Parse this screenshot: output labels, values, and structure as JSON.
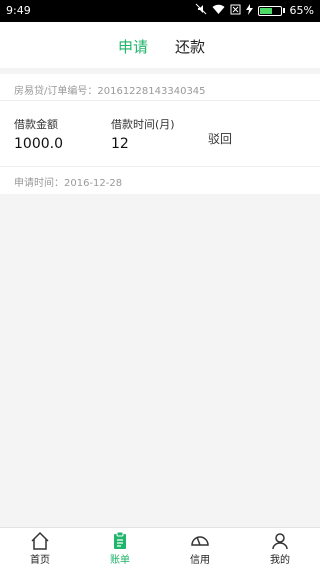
{
  "statusbar": {
    "time": "9:49",
    "battery_pct": "65%",
    "battery_level": 0.65
  },
  "tabs": [
    {
      "label": "申请",
      "active": true
    },
    {
      "label": "还款",
      "active": false
    }
  ],
  "order": {
    "line": "房易贷/订单编号：20161228143340345",
    "amount_label": "借款金额",
    "amount_value": "1000.0",
    "term_label": "借款时间(月)",
    "term_value": "12",
    "status": "驳回",
    "apply_time": "申请时间：2016-12-28"
  },
  "nav": [
    {
      "label": "首页",
      "icon": "home-icon"
    },
    {
      "label": "账单",
      "icon": "bill-icon",
      "active": true
    },
    {
      "label": "信用",
      "icon": "credit-icon"
    },
    {
      "label": "我的",
      "icon": "profile-icon"
    }
  ],
  "colors": {
    "accent": "#1fb56a"
  }
}
